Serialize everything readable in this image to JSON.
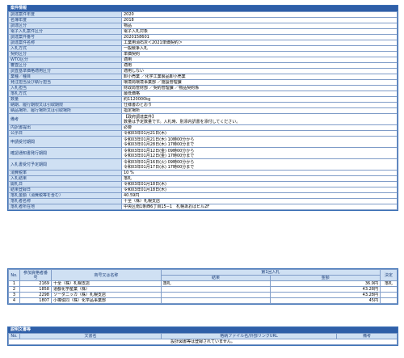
{
  "section1": {
    "title": "案件情報",
    "rows": [
      {
        "label": "調達案件年度",
        "lines": [
          "2020"
        ]
      },
      {
        "label": "名簿年度",
        "lines": [
          "2018"
        ]
      },
      {
        "label": "調達区分",
        "lines": [
          "物品"
        ]
      },
      {
        "label": "電子入札案件区分",
        "lines": [
          "電子入札対象"
        ]
      },
      {
        "label": "調達案件番号",
        "lines": [
          "2020158601"
        ]
      },
      {
        "label": "調達案件名称",
        "lines": [
          "工業用消石灰＜2021単価契約＞"
        ]
      },
      {
        "label": "入札方式",
        "lines": [
          "一般競争入札"
        ]
      },
      {
        "label": "契約区分",
        "lines": [
          "単価契約"
        ]
      },
      {
        "label": "WTO区分",
        "lines": [
          "適用"
        ]
      },
      {
        "label": "審査区分",
        "lines": [
          "適用"
        ]
      },
      {
        "label": "調査基準価格適用区分",
        "lines": [
          "適用しない"
        ]
      },
      {
        "label": "業種／種目",
        "lines": [
          "卸小売業 ／化学工業製品卸小売業"
        ]
      },
      {
        "label": "発注担当及び執行担当",
        "lines": [
          "環境局環境事業部 ／施設管理課"
        ]
      },
      {
        "label": "入札担当",
        "lines": [
          "財政局管財部 ／契約管理課 ／物品契約係"
        ]
      },
      {
        "label": "落札方式",
        "lines": [
          "最低価格"
        ]
      },
      {
        "label": "数量",
        "lines": [
          "約1120000kg"
        ]
      },
      {
        "label": "納期、履行期限又は引取期限",
        "lines": [
          "仕様書のとおり"
        ]
      },
      {
        "label": "納品場所、履行場所又は引取場所",
        "lines": [
          "指定場所"
        ]
      },
      {
        "label": "備考",
        "lines": [
          "【政府調達案件】",
          "数量は予定数量です。入札時、別添内訳書を添付してください。"
        ]
      },
      {
        "label": "内訳書提出",
        "lines": [
          "必要"
        ]
      },
      {
        "label": "公示日",
        "lines": [
          "令和03年01月21日(木)"
        ]
      },
      {
        "label": "申請受付期間",
        "lines": [
          "令和03年01月21日(木) 10時00分から",
          "令和03年01月28日(木) 17時00分まで"
        ]
      },
      {
        "label": "確認通知書発行期間",
        "lines": [
          "令和03年01月12日(金) 09時00分から",
          "令和03年01月12日(金) 17時00分まで"
        ]
      },
      {
        "label": "入札書受付予定期間",
        "lines": [
          "令和03年01月16日(火) 09時00分から",
          "令和03年01月17日(水) 17時00分まで"
        ]
      },
      {
        "label": "消費税率",
        "lines": [
          "10 %"
        ]
      },
      {
        "label": "入札結果",
        "lines": [
          "落札"
        ]
      },
      {
        "label": "開札日",
        "lines": [
          "令和03年01月18日(木)"
        ]
      },
      {
        "label": "結果登録日",
        "lines": [
          "令和03年01月18日(木)"
        ]
      },
      {
        "label": "落札金額（消費税等を含む）",
        "lines": [
          "40.59円"
        ]
      },
      {
        "label": "落札者名称",
        "lines": [
          "十全（株）札幌支店"
        ]
      },
      {
        "label": "落札者所在地",
        "lines": [
          "中央区南1条西6丁目15−1　札幌あおばビル2F"
        ]
      }
    ]
  },
  "bids": {
    "headers": {
      "no": "No.",
      "reg": "参加資格者番号",
      "name": "商号又は名称",
      "round": "第1回入札",
      "result": "結果",
      "amount": "金額",
      "decision": "決定"
    },
    "rows": [
      {
        "no": "1",
        "reg": "2169",
        "name": "十全（株）札幌支店",
        "result": "落札",
        "amount": "36.9円",
        "decision": "落札"
      },
      {
        "no": "2",
        "reg": "1858",
        "name": "道都化学産業（株）",
        "result": "",
        "amount": "43.28円",
        "decision": ""
      },
      {
        "no": "3",
        "reg": "2298",
        "name": "ソーダニッカ（株）札幌支店",
        "result": "",
        "amount": "43.28円",
        "decision": ""
      },
      {
        "no": "4",
        "reg": "1807",
        "name": "小樽協同（株）化学品事業部",
        "result": "",
        "amount": "45円",
        "decision": ""
      }
    ]
  },
  "section2": {
    "title": "説明文書等",
    "headers": {
      "no": "No.",
      "doc": "文書名",
      "link": "格納ファイル名/外部リンクURL",
      "note": "備考"
    },
    "empty_message": "設計図書等は登録されていません。"
  },
  "colors": {
    "header": "#2f5fa8",
    "label_bg": "#cfe0f3",
    "border": "#7f9cc8"
  }
}
